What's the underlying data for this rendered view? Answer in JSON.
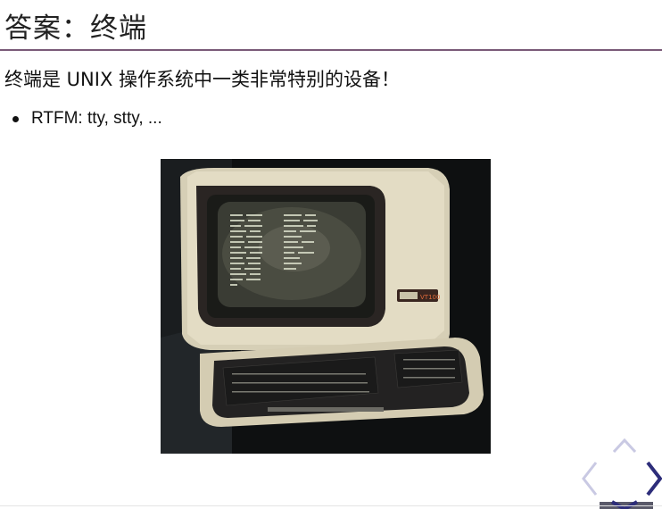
{
  "slide": {
    "title": "答案：终端",
    "intro": "终端是 UNIX 操作系统中一类非常特别的设备！",
    "bullets": [
      "RTFM: tty, stty, ..."
    ],
    "screen_text": "VT100"
  },
  "navigation": {
    "up_icon": "chevron-up-icon",
    "left_icon": "chevron-left-icon",
    "right_icon": "chevron-right-icon",
    "down_icon": "chevron-down-icon",
    "colors": {
      "active": "#2d2d7a",
      "inactive": "#c9c9e3"
    }
  },
  "colors": {
    "rule": "#7a5a78"
  }
}
